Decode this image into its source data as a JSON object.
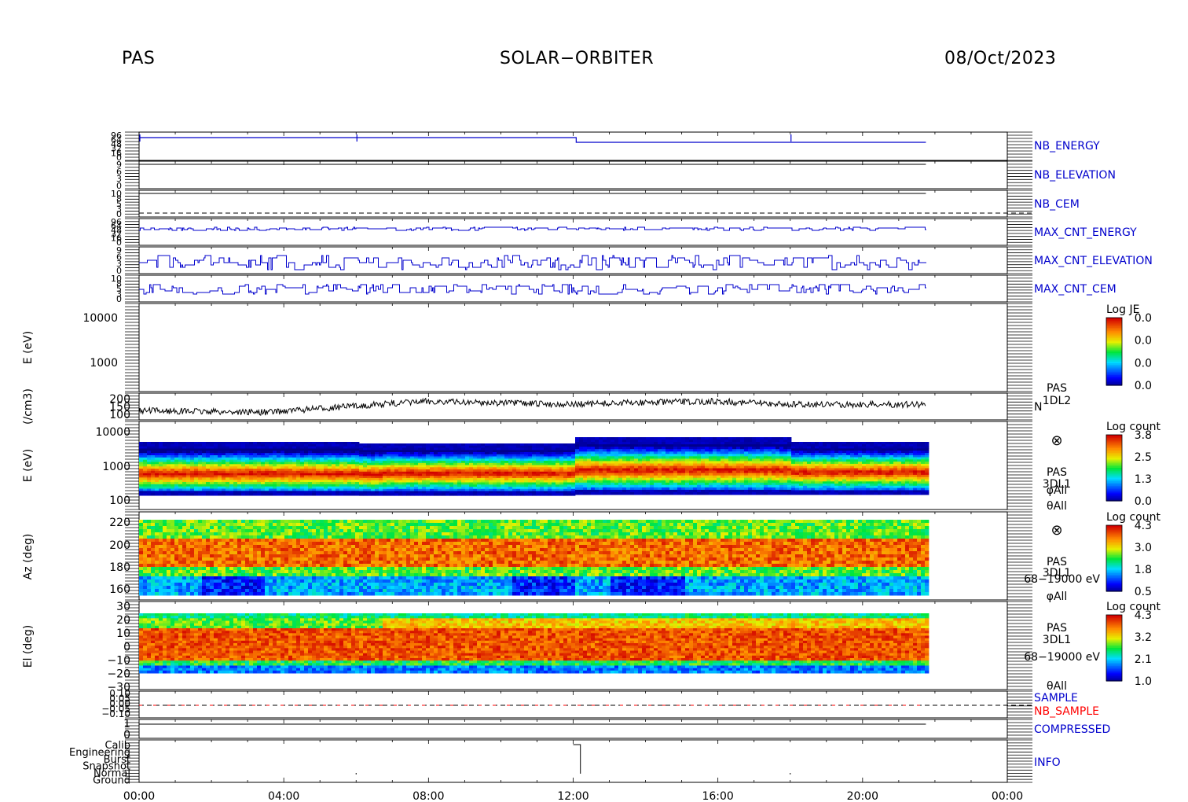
{
  "header": {
    "instrument": "PAS",
    "mission": "SOLAR−ORBITER",
    "date": "08/Oct/2023"
  },
  "colors": {
    "blue_trace": "#0000cc",
    "black_trace": "#000000",
    "red_trace": "#ff0000"
  },
  "chart_data": [
    {
      "type": "line",
      "title": "",
      "ylabel": "",
      "label": "NB_ENERGY",
      "label_color": "#0000cc",
      "x_range": [
        "00:00",
        "24:00"
      ],
      "data_end": "21:45",
      "series": [
        {
          "values_note": "step",
          "x": [
            "00:00",
            "12:05",
            "12:05",
            "21:45"
          ],
          "values": [
            1,
            1,
            0,
            0
          ]
        }
      ],
      "ytick_labels": [
        "96",
        "64",
        "48",
        "32",
        "16",
        "0"
      ]
    },
    {
      "type": "line",
      "label": "NB_ELEVATION",
      "label_color": "#0000cc",
      "ytick_labels": [
        "9",
        "6",
        "3",
        "0"
      ]
    },
    {
      "type": "line",
      "label": "NB_CEM",
      "label_color": "#0000cc",
      "ytick_labels": [
        "10",
        "8",
        "5",
        "3",
        "0"
      ]
    },
    {
      "type": "line",
      "label": "MAX_CNT_ENERGY",
      "label_color": "#0000cc",
      "ytick_labels": [
        "96",
        "64",
        "48",
        "32",
        "16",
        "0"
      ]
    },
    {
      "type": "line",
      "label": "MAX_CNT_ELEVATION",
      "label_color": "#0000cc",
      "ytick_labels": [
        "9",
        "6",
        "3",
        "0"
      ]
    },
    {
      "type": "line",
      "label": "MAX_CNT_CEM",
      "label_color": "#0000cc",
      "ytick_labels": [
        "10",
        "8",
        "5",
        "3",
        "0"
      ]
    },
    {
      "type": "heatmap",
      "ylabel": "E (eV)",
      "yscale": "log",
      "ylim": [
        80,
        20000
      ],
      "ytick_labels": [
        "10000",
        "1000"
      ],
      "colorbar": {
        "title": "Log JE",
        "ticks": [
          "0.0",
          "0.0",
          "0.0",
          "0.0"
        ]
      }
    },
    {
      "type": "line",
      "ylabel": "(/cm3)",
      "label": "N",
      "side_label": [
        "PAS",
        "1DL2"
      ],
      "ylim": [
        100,
        200
      ],
      "ytick_labels": [
        "200",
        "150",
        "100"
      ],
      "series": [
        {
          "name": "N",
          "x": [
            "00:00",
            "02:00",
            "03:30",
            "05:00",
            "07:00",
            "08:00",
            "12:00",
            "14:00",
            "16:00",
            "18:00",
            "21:45"
          ],
          "values": [
            130,
            125,
            122,
            140,
            165,
            175,
            160,
            170,
            175,
            160,
            160
          ]
        }
      ]
    },
    {
      "type": "heatmap",
      "ylabel": "E (eV)",
      "yscale": "log",
      "ylim": [
        80,
        15000
      ],
      "ytick_labels": [
        "10000",
        "1000",
        "100"
      ],
      "side_label": [
        "⊗",
        "PAS",
        "3DL1",
        "φAll",
        "θAll"
      ],
      "colorbar": {
        "title": "Log count",
        "ticks": [
          "3.8",
          "2.5",
          "1.3",
          "0.0"
        ]
      }
    },
    {
      "type": "heatmap",
      "ylabel": "Az (deg)",
      "ylim": [
        150,
        230
      ],
      "ytick_labels": [
        "220",
        "200",
        "180",
        "160"
      ],
      "side_label": [
        "⊗",
        "PAS",
        "3DL1",
        "68−19000 eV",
        "φAll"
      ],
      "colorbar": {
        "title": "Log count",
        "ticks": [
          "4.3",
          "3.0",
          "1.8",
          "0.5"
        ]
      }
    },
    {
      "type": "heatmap",
      "ylabel": "El (deg)",
      "ylim": [
        -30,
        30
      ],
      "ytick_labels": [
        "30",
        "20",
        "10",
        "0",
        "−10",
        "−20",
        "−30"
      ],
      "side_label": [
        "PAS",
        "3DL1",
        "68−19000 eV",
        "θAll"
      ],
      "colorbar": {
        "title": "Log count",
        "ticks": [
          "4.3",
          "3.2",
          "2.1",
          "1.0"
        ]
      }
    },
    {
      "type": "line",
      "labels": [
        "SAMPLE",
        "NB_SAMPLE"
      ],
      "label_colors": [
        "#0000cc",
        "#ff0000"
      ],
      "ytick_labels": [
        "0.10",
        "0.05",
        "0.00",
        "−0.05",
        "−0.10"
      ]
    },
    {
      "type": "line",
      "label": "COMPRESSED",
      "label_color": "#0000cc",
      "ytick_labels": [
        "1",
        "0"
      ]
    },
    {
      "type": "line",
      "label": "INFO",
      "label_color": "#0000cc",
      "ytick_labels": [
        "Calib",
        "Engineering",
        "Burst",
        "Snapshot",
        "Normal",
        "Ground"
      ]
    }
  ],
  "xaxis": {
    "tick_labels": [
      "00:00",
      "04:00",
      "08:00",
      "12:00",
      "16:00",
      "20:00",
      "00:00"
    ]
  }
}
